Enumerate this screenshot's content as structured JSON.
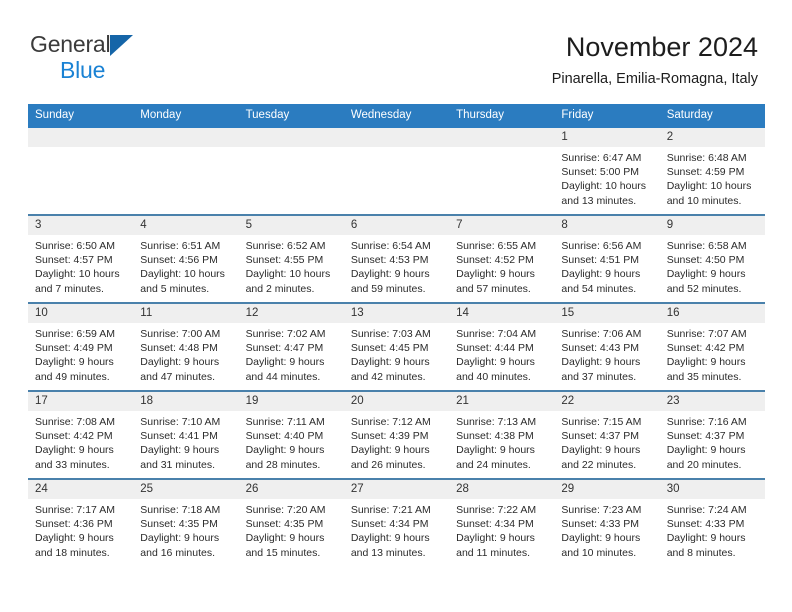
{
  "brand": {
    "line1": "General",
    "line2": "Blue",
    "triangle_color": "#1565a8",
    "blue_color": "#1a82d4"
  },
  "header": {
    "title": "November 2024",
    "subtitle": "Pinarella, Emilia-Romagna, Italy"
  },
  "theme": {
    "header_blue": "#2b7cc0",
    "row_separator": "#4a81ab",
    "daynum_band": "#efefef",
    "text": "#2b2b2b"
  },
  "calendar": {
    "weekday_headers": [
      "Sunday",
      "Monday",
      "Tuesday",
      "Wednesday",
      "Thursday",
      "Friday",
      "Saturday"
    ],
    "weeks": [
      [
        {
          "day": "",
          "sunrise": "",
          "sunset": "",
          "daylight_a": "",
          "daylight_b": ""
        },
        {
          "day": "",
          "sunrise": "",
          "sunset": "",
          "daylight_a": "",
          "daylight_b": ""
        },
        {
          "day": "",
          "sunrise": "",
          "sunset": "",
          "daylight_a": "",
          "daylight_b": ""
        },
        {
          "day": "",
          "sunrise": "",
          "sunset": "",
          "daylight_a": "",
          "daylight_b": ""
        },
        {
          "day": "",
          "sunrise": "",
          "sunset": "",
          "daylight_a": "",
          "daylight_b": ""
        },
        {
          "day": "1",
          "sunrise": "Sunrise: 6:47 AM",
          "sunset": "Sunset: 5:00 PM",
          "daylight_a": "Daylight: 10 hours",
          "daylight_b": "and 13 minutes."
        },
        {
          "day": "2",
          "sunrise": "Sunrise: 6:48 AM",
          "sunset": "Sunset: 4:59 PM",
          "daylight_a": "Daylight: 10 hours",
          "daylight_b": "and 10 minutes."
        }
      ],
      [
        {
          "day": "3",
          "sunrise": "Sunrise: 6:50 AM",
          "sunset": "Sunset: 4:57 PM",
          "daylight_a": "Daylight: 10 hours",
          "daylight_b": "and 7 minutes."
        },
        {
          "day": "4",
          "sunrise": "Sunrise: 6:51 AM",
          "sunset": "Sunset: 4:56 PM",
          "daylight_a": "Daylight: 10 hours",
          "daylight_b": "and 5 minutes."
        },
        {
          "day": "5",
          "sunrise": "Sunrise: 6:52 AM",
          "sunset": "Sunset: 4:55 PM",
          "daylight_a": "Daylight: 10 hours",
          "daylight_b": "and 2 minutes."
        },
        {
          "day": "6",
          "sunrise": "Sunrise: 6:54 AM",
          "sunset": "Sunset: 4:53 PM",
          "daylight_a": "Daylight: 9 hours",
          "daylight_b": "and 59 minutes."
        },
        {
          "day": "7",
          "sunrise": "Sunrise: 6:55 AM",
          "sunset": "Sunset: 4:52 PM",
          "daylight_a": "Daylight: 9 hours",
          "daylight_b": "and 57 minutes."
        },
        {
          "day": "8",
          "sunrise": "Sunrise: 6:56 AM",
          "sunset": "Sunset: 4:51 PM",
          "daylight_a": "Daylight: 9 hours",
          "daylight_b": "and 54 minutes."
        },
        {
          "day": "9",
          "sunrise": "Sunrise: 6:58 AM",
          "sunset": "Sunset: 4:50 PM",
          "daylight_a": "Daylight: 9 hours",
          "daylight_b": "and 52 minutes."
        }
      ],
      [
        {
          "day": "10",
          "sunrise": "Sunrise: 6:59 AM",
          "sunset": "Sunset: 4:49 PM",
          "daylight_a": "Daylight: 9 hours",
          "daylight_b": "and 49 minutes."
        },
        {
          "day": "11",
          "sunrise": "Sunrise: 7:00 AM",
          "sunset": "Sunset: 4:48 PM",
          "daylight_a": "Daylight: 9 hours",
          "daylight_b": "and 47 minutes."
        },
        {
          "day": "12",
          "sunrise": "Sunrise: 7:02 AM",
          "sunset": "Sunset: 4:47 PM",
          "daylight_a": "Daylight: 9 hours",
          "daylight_b": "and 44 minutes."
        },
        {
          "day": "13",
          "sunrise": "Sunrise: 7:03 AM",
          "sunset": "Sunset: 4:45 PM",
          "daylight_a": "Daylight: 9 hours",
          "daylight_b": "and 42 minutes."
        },
        {
          "day": "14",
          "sunrise": "Sunrise: 7:04 AM",
          "sunset": "Sunset: 4:44 PM",
          "daylight_a": "Daylight: 9 hours",
          "daylight_b": "and 40 minutes."
        },
        {
          "day": "15",
          "sunrise": "Sunrise: 7:06 AM",
          "sunset": "Sunset: 4:43 PM",
          "daylight_a": "Daylight: 9 hours",
          "daylight_b": "and 37 minutes."
        },
        {
          "day": "16",
          "sunrise": "Sunrise: 7:07 AM",
          "sunset": "Sunset: 4:42 PM",
          "daylight_a": "Daylight: 9 hours",
          "daylight_b": "and 35 minutes."
        }
      ],
      [
        {
          "day": "17",
          "sunrise": "Sunrise: 7:08 AM",
          "sunset": "Sunset: 4:42 PM",
          "daylight_a": "Daylight: 9 hours",
          "daylight_b": "and 33 minutes."
        },
        {
          "day": "18",
          "sunrise": "Sunrise: 7:10 AM",
          "sunset": "Sunset: 4:41 PM",
          "daylight_a": "Daylight: 9 hours",
          "daylight_b": "and 31 minutes."
        },
        {
          "day": "19",
          "sunrise": "Sunrise: 7:11 AM",
          "sunset": "Sunset: 4:40 PM",
          "daylight_a": "Daylight: 9 hours",
          "daylight_b": "and 28 minutes."
        },
        {
          "day": "20",
          "sunrise": "Sunrise: 7:12 AM",
          "sunset": "Sunset: 4:39 PM",
          "daylight_a": "Daylight: 9 hours",
          "daylight_b": "and 26 minutes."
        },
        {
          "day": "21",
          "sunrise": "Sunrise: 7:13 AM",
          "sunset": "Sunset: 4:38 PM",
          "daylight_a": "Daylight: 9 hours",
          "daylight_b": "and 24 minutes."
        },
        {
          "day": "22",
          "sunrise": "Sunrise: 7:15 AM",
          "sunset": "Sunset: 4:37 PM",
          "daylight_a": "Daylight: 9 hours",
          "daylight_b": "and 22 minutes."
        },
        {
          "day": "23",
          "sunrise": "Sunrise: 7:16 AM",
          "sunset": "Sunset: 4:37 PM",
          "daylight_a": "Daylight: 9 hours",
          "daylight_b": "and 20 minutes."
        }
      ],
      [
        {
          "day": "24",
          "sunrise": "Sunrise: 7:17 AM",
          "sunset": "Sunset: 4:36 PM",
          "daylight_a": "Daylight: 9 hours",
          "daylight_b": "and 18 minutes."
        },
        {
          "day": "25",
          "sunrise": "Sunrise: 7:18 AM",
          "sunset": "Sunset: 4:35 PM",
          "daylight_a": "Daylight: 9 hours",
          "daylight_b": "and 16 minutes."
        },
        {
          "day": "26",
          "sunrise": "Sunrise: 7:20 AM",
          "sunset": "Sunset: 4:35 PM",
          "daylight_a": "Daylight: 9 hours",
          "daylight_b": "and 15 minutes."
        },
        {
          "day": "27",
          "sunrise": "Sunrise: 7:21 AM",
          "sunset": "Sunset: 4:34 PM",
          "daylight_a": "Daylight: 9 hours",
          "daylight_b": "and 13 minutes."
        },
        {
          "day": "28",
          "sunrise": "Sunrise: 7:22 AM",
          "sunset": "Sunset: 4:34 PM",
          "daylight_a": "Daylight: 9 hours",
          "daylight_b": "and 11 minutes."
        },
        {
          "day": "29",
          "sunrise": "Sunrise: 7:23 AM",
          "sunset": "Sunset: 4:33 PM",
          "daylight_a": "Daylight: 9 hours",
          "daylight_b": "and 10 minutes."
        },
        {
          "day": "30",
          "sunrise": "Sunrise: 7:24 AM",
          "sunset": "Sunset: 4:33 PM",
          "daylight_a": "Daylight: 9 hours",
          "daylight_b": "and 8 minutes."
        }
      ]
    ]
  }
}
